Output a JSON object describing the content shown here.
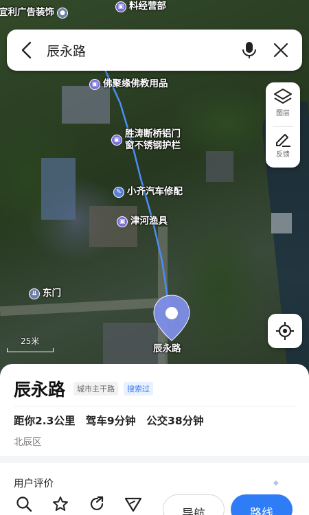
{
  "map": {
    "poi_top": [
      {
        "label": "宜利广告装饰"
      },
      {
        "label": "料经营部"
      }
    ],
    "pois": [
      {
        "label": "佛聚缘佛教用品",
        "icon": "shop-icon"
      },
      {
        "label_line1": "胜涛断桥铝门",
        "label_line2": "窗不锈钢护栏",
        "icon": "shop-icon"
      },
      {
        "label": "小齐汽车修配",
        "icon": "wrench-icon"
      },
      {
        "label": "津河渔具",
        "icon": "shop-icon"
      },
      {
        "label": "东门",
        "icon": "gate-icon"
      }
    ],
    "marker_label": "辰永路",
    "scale_label": "25米",
    "route_color": "#4a8ef5"
  },
  "search": {
    "query": "辰永路"
  },
  "tools": {
    "layers_label": "图层",
    "feedback_label": "反馈"
  },
  "place": {
    "name": "辰永路",
    "type_tag": "城市主干路",
    "history_tag": "搜索过",
    "distance": "距你2.3公里",
    "drive": "驾车9分钟",
    "transit": "公交38分钟",
    "district": "北辰区",
    "reviews_heading": "用户评价"
  },
  "actions": {
    "navigate_label": "导航",
    "route_label": "路线",
    "accent_color": "#2f7df6"
  }
}
